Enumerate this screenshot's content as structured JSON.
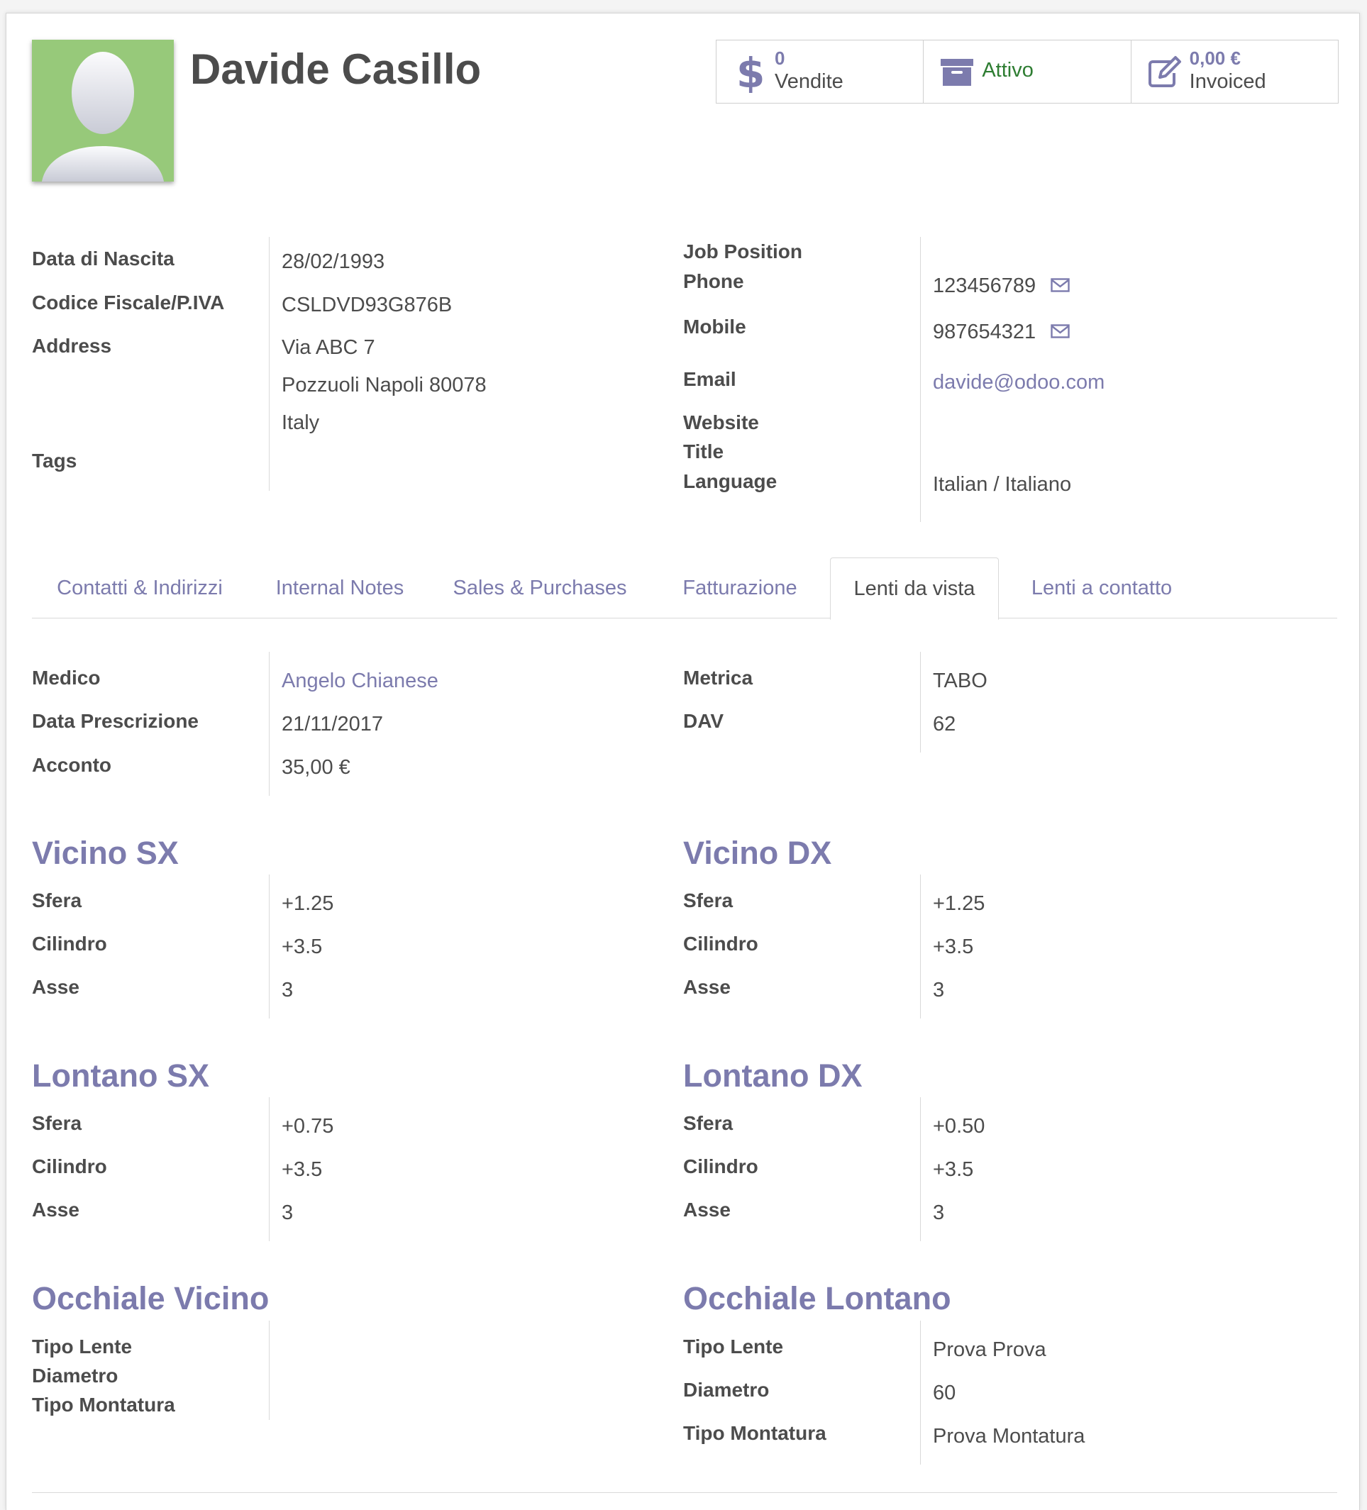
{
  "header": {
    "name": "Davide Casillo",
    "avatar_icon": "user-placeholder-icon"
  },
  "stats": {
    "sales": {
      "count": "0",
      "label": "Vendite",
      "icon": "dollar-icon"
    },
    "active": {
      "label": "Attivo",
      "icon": "archive-icon"
    },
    "invoiced": {
      "amount": "0,00 €",
      "label": "Invoiced",
      "icon": "edit-icon"
    }
  },
  "left_fields": {
    "birth_date": {
      "label": "Data di Nascita",
      "value": "28/02/1993"
    },
    "tax_code": {
      "label": "Codice Fiscale/P.IVA",
      "value": "CSLDVD93G876B"
    },
    "address": {
      "label": "Address",
      "street": "Via ABC 7",
      "city_line": "Pozzuoli Napoli 80078",
      "country": "Italy"
    },
    "tags": {
      "label": "Tags"
    }
  },
  "right_fields": {
    "job_position": {
      "label": "Job Position"
    },
    "phone": {
      "label": "Phone",
      "value": "123456789"
    },
    "mobile": {
      "label": "Mobile",
      "value": "987654321"
    },
    "email": {
      "label": "Email",
      "value": "davide@odoo.com"
    },
    "website": {
      "label": "Website"
    },
    "title": {
      "label": "Title"
    },
    "language": {
      "label": "Language",
      "value": "Italian / Italiano"
    }
  },
  "tabs": [
    {
      "label": "Contatti & Indirizzi",
      "active": false
    },
    {
      "label": "Internal Notes",
      "active": false
    },
    {
      "label": "Sales & Purchases",
      "active": false
    },
    {
      "label": "Fatturazione",
      "active": false
    },
    {
      "label": "Lenti da vista",
      "active": true
    },
    {
      "label": "Lenti a contatto",
      "active": false
    }
  ],
  "prescription": {
    "doctor": {
      "label": "Medico",
      "value": "Angelo Chianese"
    },
    "date": {
      "label": "Data Prescrizione",
      "value": "21/11/2017"
    },
    "deposit": {
      "label": "Acconto",
      "value": "35,00 €"
    },
    "metric": {
      "label": "Metrica",
      "value": "TABO"
    },
    "dav": {
      "label": "DAV",
      "value": "62"
    }
  },
  "near_left": {
    "title": "Vicino SX",
    "sphere": {
      "label": "Sfera",
      "value": "+1.25"
    },
    "cylinder": {
      "label": "Cilindro",
      "value": "+3.5"
    },
    "axis": {
      "label": "Asse",
      "value": "3"
    }
  },
  "near_right": {
    "title": "Vicino DX",
    "sphere": {
      "label": "Sfera",
      "value": "+1.25"
    },
    "cylinder": {
      "label": "Cilindro",
      "value": "+3.5"
    },
    "axis": {
      "label": "Asse",
      "value": "3"
    }
  },
  "far_left": {
    "title": "Lontano SX",
    "sphere": {
      "label": "Sfera",
      "value": "+0.75"
    },
    "cylinder": {
      "label": "Cilindro",
      "value": "+3.5"
    },
    "axis": {
      "label": "Asse",
      "value": "3"
    }
  },
  "far_right": {
    "title": "Lontano DX",
    "sphere": {
      "label": "Sfera",
      "value": "+0.50"
    },
    "cylinder": {
      "label": "Cilindro",
      "value": "+3.5"
    },
    "axis": {
      "label": "Asse",
      "value": "3"
    }
  },
  "glasses_near": {
    "title": "Occhiale Vicino",
    "lens_type": {
      "label": "Tipo Lente"
    },
    "diameter": {
      "label": "Diametro"
    },
    "frame_type": {
      "label": "Tipo Montatura"
    }
  },
  "glasses_far": {
    "title": "Occhiale Lontano",
    "lens_type": {
      "label": "Tipo Lente",
      "value": "Prova Prova"
    },
    "diameter": {
      "label": "Diametro",
      "value": "60"
    },
    "frame_type": {
      "label": "Tipo Montatura",
      "value": "Prova Montatura"
    }
  },
  "colors": {
    "accent": "#7c7bad",
    "active_green": "#2e7d32",
    "avatar_bg": "#97c97a",
    "text": "#4c4c4c"
  }
}
